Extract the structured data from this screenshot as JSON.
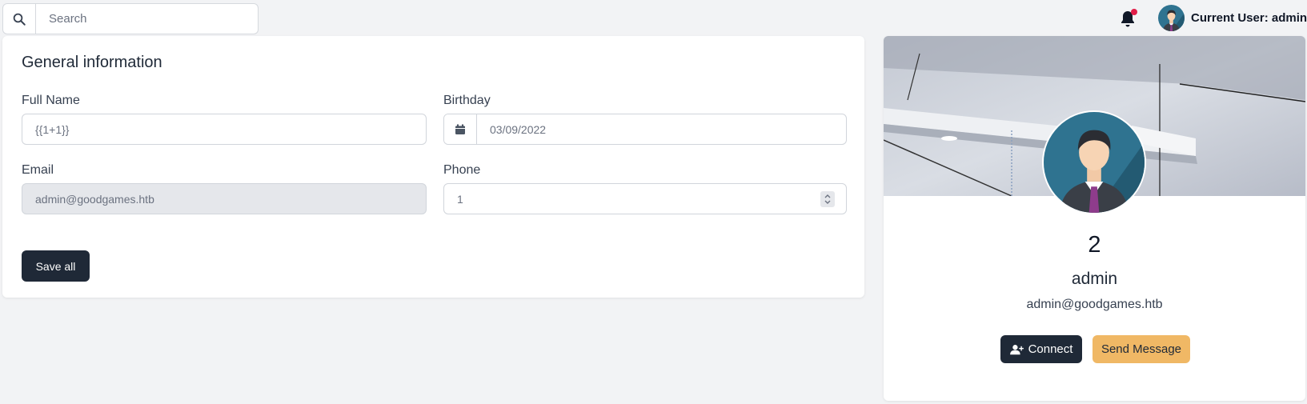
{
  "topbar": {
    "search_placeholder": "Search",
    "notification_badge_color": "#e11d48",
    "current_user_label": "Current User: admin"
  },
  "general": {
    "title": "General information",
    "full_name": {
      "label": "Full Name",
      "value": "{{1+1}}"
    },
    "birthday": {
      "label": "Birthday",
      "value": "03/09/2022"
    },
    "email": {
      "label": "Email",
      "value": "admin@goodgames.htb"
    },
    "phone": {
      "label": "Phone",
      "value": "1"
    },
    "save_label": "Save all"
  },
  "profile": {
    "display_name_value": "2",
    "username": "admin",
    "email": "admin@goodgames.htb",
    "connect_label": "Connect",
    "message_label": "Send Message"
  },
  "colors": {
    "primary_dark": "#1f2937",
    "accent": "#f0b865",
    "background": "#f2f3f5"
  }
}
